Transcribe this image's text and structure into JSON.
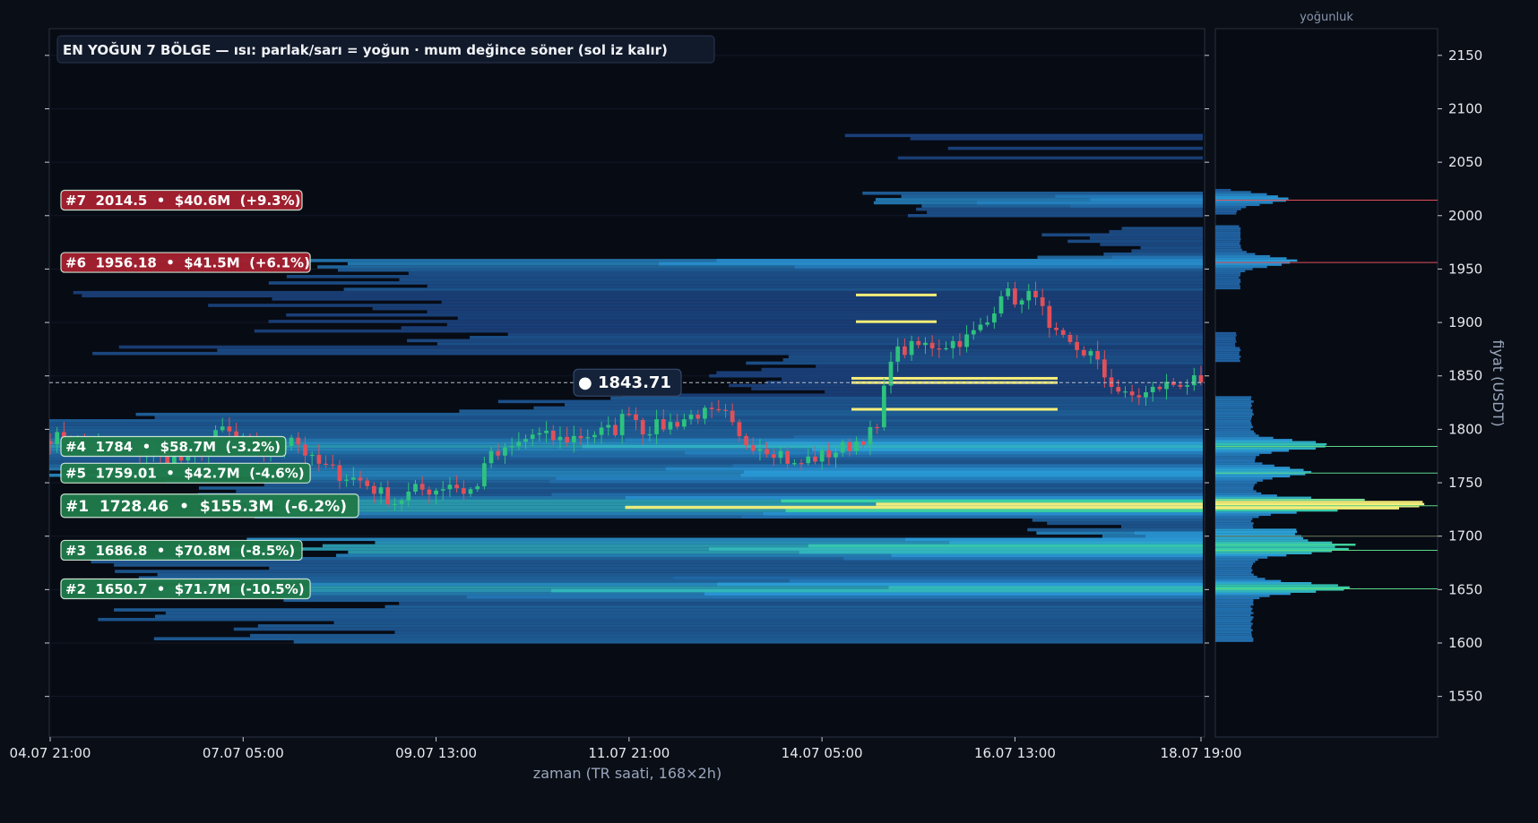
{
  "chart_data": {
    "type": "heatmap",
    "title": "EN YOĞUN 7 BÖLGE — ısı: parlak/sarı = yoğun · mum değince söner (sol iz kalır)",
    "xlabel": "zaman (TR saati, 168×2h)",
    "ylabel": "fiyat (USDT)",
    "profile_title": "yoğunluk",
    "ylim": [
      1512,
      2175
    ],
    "y_ticks": [
      1550,
      1600,
      1650,
      1700,
      1750,
      1800,
      1850,
      1900,
      1950,
      2000,
      2050,
      2100,
      2150
    ],
    "x_tick_labels": [
      "04.07 21:00",
      "07.07 05:00",
      "09.07 13:00",
      "11.07 21:00",
      "14.07 05:00",
      "16.07 13:00",
      "18.07 19:00"
    ],
    "x_ticks_at_bar": [
      0,
      28,
      56,
      84,
      112,
      140,
      167
    ],
    "n_bars": 168,
    "bar_hours": 2,
    "current_price": 1843.71,
    "current_price_label": "● 1843.71",
    "candle_close_path": [
      [
        0,
        1793
      ],
      [
        5,
        1786
      ],
      [
        10,
        1781
      ],
      [
        15,
        1776
      ],
      [
        20,
        1770
      ],
      [
        22,
        1780
      ],
      [
        25,
        1800
      ],
      [
        28,
        1788
      ],
      [
        32,
        1778
      ],
      [
        35,
        1795
      ],
      [
        38,
        1770
      ],
      [
        42,
        1758
      ],
      [
        45,
        1752
      ],
      [
        48,
        1740
      ],
      [
        50,
        1732
      ],
      [
        53,
        1743
      ],
      [
        56,
        1744
      ],
      [
        58,
        1750
      ],
      [
        60,
        1742
      ],
      [
        62,
        1745
      ],
      [
        63,
        1772
      ],
      [
        66,
        1778
      ],
      [
        70,
        1795
      ],
      [
        74,
        1790
      ],
      [
        78,
        1795
      ],
      [
        82,
        1800
      ],
      [
        84,
        1820
      ],
      [
        86,
        1800
      ],
      [
        90,
        1805
      ],
      [
        94,
        1815
      ],
      [
        98,
        1812
      ],
      [
        100,
        1790
      ],
      [
        103,
        1785
      ],
      [
        106,
        1778
      ],
      [
        108,
        1765
      ],
      [
        110,
        1772
      ],
      [
        112,
        1775
      ],
      [
        116,
        1785
      ],
      [
        120,
        1800
      ],
      [
        122,
        1870
      ],
      [
        126,
        1878
      ],
      [
        130,
        1880
      ],
      [
        133,
        1885
      ],
      [
        136,
        1900
      ],
      [
        138,
        1930
      ],
      [
        141,
        1918
      ],
      [
        143,
        1930
      ],
      [
        145,
        1890
      ],
      [
        148,
        1878
      ],
      [
        151,
        1870
      ],
      [
        153,
        1850
      ],
      [
        156,
        1830
      ],
      [
        159,
        1833
      ],
      [
        161,
        1840
      ],
      [
        164,
        1844
      ],
      [
        167,
        1843.71
      ]
    ],
    "zones": [
      {
        "rank": 1,
        "price": 1728.46,
        "volume": "$155.3M",
        "change": "-6.2%",
        "label": "#1  1728.46  •  $155.3M  (-6.2%)",
        "color": "#1f7a4a",
        "line_color": "#5cd68a"
      },
      {
        "rank": 2,
        "price": 1650.7,
        "volume": "$71.7M",
        "change": "-10.5%",
        "label": "#2  1650.7  •  $71.7M  (-10.5%)",
        "color": "#1f7a4a",
        "line_color": "#5cd68a"
      },
      {
        "rank": 3,
        "price": 1686.8,
        "volume": "$70.8M",
        "change": "-8.5%",
        "label": "#3  1686.8  •  $70.8M  (-8.5%)",
        "color": "#1f7a4a",
        "line_color": "#5cd68a"
      },
      {
        "rank": 4,
        "price": 1784,
        "volume": "$58.7M",
        "change": "-3.2%",
        "label": "#4  1784  •  $58.7M  (-3.2%)",
        "color": "#1f7a4a",
        "line_color": "#5cd68a"
      },
      {
        "rank": 5,
        "price": 1759.01,
        "volume": "$42.7M",
        "change": "-4.6%",
        "label": "#5  1759.01  •  $42.7M  (-4.6%)",
        "color": "#1f7a4a",
        "line_color": "#5cd68a"
      },
      {
        "rank": 6,
        "price": 1956.18,
        "volume": "$41.5M",
        "change": "+6.1%",
        "label": "#6  1956.18  •  $41.5M  (+6.1%)",
        "color": "#a3202f",
        "line_color": "#e0505a"
      },
      {
        "rank": 7,
        "price": 2014.5,
        "volume": "$40.6M",
        "change": "+9.3%",
        "label": "#7  2014.5  •  $40.6M  (+9.3%)",
        "color": "#a3202f",
        "line_color": "#e0505a"
      }
    ],
    "colors": {
      "background": "#0a0e16",
      "axis": "#2a3140",
      "tick_text": "#e6e9ef",
      "up": "#2ec27e",
      "down": "#e0505a",
      "heat_low": "#1a3a7a",
      "heat_mid": "#2a9bd8",
      "heat_high": "#3ad4a0",
      "heat_peak": "#f7ef7a"
    }
  }
}
